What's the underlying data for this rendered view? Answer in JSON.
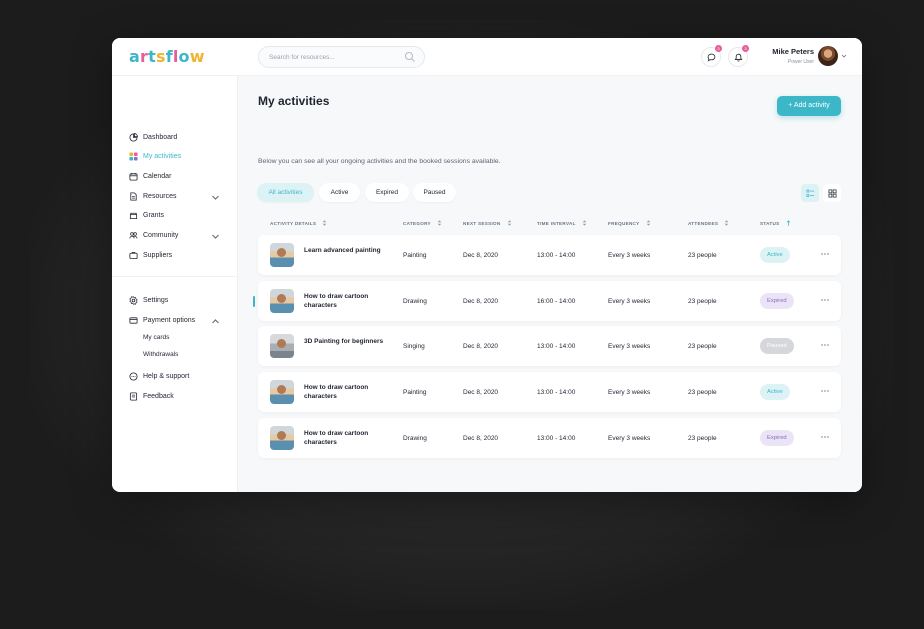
{
  "app": {
    "logo": [
      "a",
      "r",
      "t",
      "s",
      "f",
      "l",
      "o",
      "w"
    ],
    "logo_colors": [
      "#3bb7c8",
      "#e85d9c",
      "#3bb7c8",
      "#f0b52f",
      "#3bb7c8",
      "#e85d9c",
      "#3bb7c8",
      "#f0b52f"
    ]
  },
  "header": {
    "search_placeholder": "Search for resources...",
    "messages_badge": "3",
    "notifications_badge": "3",
    "user_name": "Mike Peters",
    "user_role": "Power User"
  },
  "sidebar": {
    "items": [
      {
        "label": "Dashboard",
        "icon": "dashboard-icon"
      },
      {
        "label": "My activities",
        "icon": "activities-icon",
        "active": true
      },
      {
        "label": "Calendar",
        "icon": "calendar-icon"
      },
      {
        "label": "Resources",
        "icon": "resources-icon"
      },
      {
        "label": "Grants",
        "icon": "grants-icon"
      },
      {
        "label": "Community",
        "icon": "community-icon"
      },
      {
        "label": "Suppliers",
        "icon": "suppliers-icon"
      }
    ],
    "settings": [
      {
        "label": "Settings",
        "icon": "gear-icon"
      },
      {
        "label": "Payment options",
        "icon": "payment-icon"
      },
      {
        "label": "My cards"
      },
      {
        "label": "Withdrawals"
      },
      {
        "label": "Help & support",
        "icon": "help-icon"
      },
      {
        "label": "Feedback",
        "icon": "feedback-icon"
      }
    ]
  },
  "main": {
    "title": "My activities",
    "subtitle": "Below you can see all your ongoing activities and the booked sessions available.",
    "add_button": "+ Add activity",
    "filters": [
      "All activities",
      "Active",
      "Expired",
      "Paused"
    ],
    "columns": [
      "ACTIVITY DETAILS",
      "CATEGORY",
      "NEXT SESSION",
      "TIME INTERVAL",
      "FREQUENCY",
      "ATTENDEES",
      "STATUS"
    ],
    "rows": [
      {
        "title": "Learn advanced painting",
        "category": "Painting",
        "next": "Dec 8, 2020",
        "time": "13:00 - 14:00",
        "frequency": "Every 3 weeks",
        "attendees": "23 people",
        "status": "Active"
      },
      {
        "title": "How to draw cartoon characters",
        "category": "Drawing",
        "next": "Dec 8, 2020",
        "time": "16:00 - 14:00",
        "frequency": "Every 3 weeks",
        "attendees": "23 people",
        "status": "Expired"
      },
      {
        "title": "3D Painting for beginners",
        "category": "Singing",
        "next": "Dec 8, 2020",
        "time": "13:00 - 14:00",
        "frequency": "Every 3 weeks",
        "attendees": "23 people",
        "status": "Paused"
      },
      {
        "title": "How to draw cartoon characters",
        "category": "Painting",
        "next": "Dec 8, 2020",
        "time": "13:00 - 14:00",
        "frequency": "Every 3 weeks",
        "attendees": "23 people",
        "status": "Active"
      },
      {
        "title": "How to draw cartoon characters",
        "category": "Drawing",
        "next": "Dec 8, 2020",
        "time": "13:00 - 14:00",
        "frequency": "Every 3 weeks",
        "attendees": "23 people",
        "status": "Expired"
      }
    ]
  },
  "colors": {
    "accent": "#3bb7c8",
    "active_bg": "#ddf2f5",
    "expired_bg": "#ebe4f6",
    "expired_text": "#8b6fc0",
    "paused_bg": "#d5d7db",
    "paused_text": "#ffffff"
  }
}
